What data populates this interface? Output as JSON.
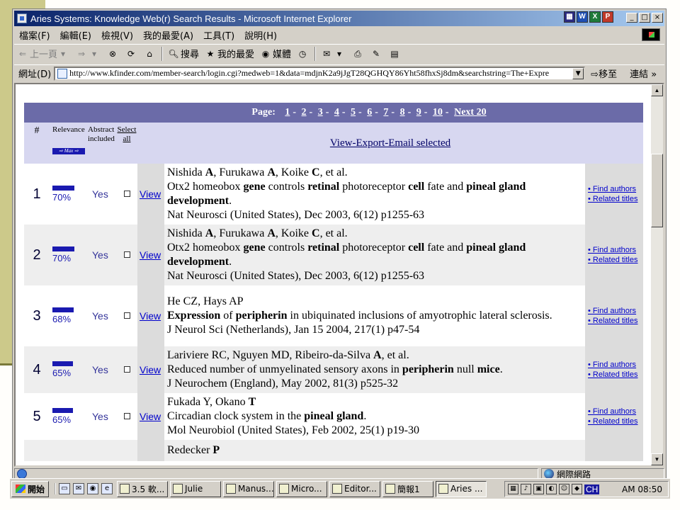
{
  "window": {
    "title": "Aries Systems: Knowledge Web(r) Search Results - Microsoft Internet Explorer",
    "buttons": [
      "_",
      "□",
      "×"
    ]
  },
  "menu": [
    "檔案(F)",
    "編輯(E)",
    "檢視(V)",
    "我的最愛(A)",
    "工具(T)",
    "說明(H)"
  ],
  "toolbar": {
    "back": "上一頁",
    "search": "搜尋",
    "favorites": "我的最愛",
    "media": "媒體"
  },
  "address": {
    "label": "網址(D)",
    "url": "http://www.kfinder.com/member-search/login.cgi?medweb=1&data=mdjnK2a9jJgT28QGHQY86Yht58fhxSj8dm&searchstring=The+Expre",
    "go": "移至",
    "links": "連結 »"
  },
  "pager": {
    "label": "Page:",
    "pages": [
      "1",
      "2",
      "3",
      "4",
      "5",
      "6",
      "7",
      "8",
      "9",
      "10"
    ],
    "next": "Next 20"
  },
  "table_header": {
    "num": "#",
    "relevance": "Relevance",
    "max": "⇨ Max ⇨",
    "abstract_1": "Abstract",
    "abstract_2": "included",
    "select_1": "Select",
    "select_2": "all",
    "export": "View-Export-Email selected"
  },
  "results": [
    {
      "num": "1",
      "relevance": "70%",
      "relevance_value": 70,
      "abstract": "Yes",
      "view": "View",
      "authors": [
        "Nishida ",
        "A",
        ", Furukawa ",
        "A",
        ", Koike ",
        "C",
        ", et al."
      ],
      "title_parts": [
        "Otx2 homeobox ",
        "gene",
        " controls ",
        "retinal",
        " photoreceptor ",
        "cell",
        " fate and ",
        "pineal gland development",
        "."
      ],
      "source": "Nat Neurosci (United States), Dec 2003, 6(12) p1255-63",
      "link1": "• Find authors",
      "link2": "• Related titles"
    },
    {
      "num": "2",
      "relevance": "70%",
      "relevance_value": 70,
      "abstract": "Yes",
      "view": "View",
      "authors": [
        "Nishida ",
        "A",
        ", Furukawa ",
        "A",
        ", Koike ",
        "C",
        ", et al."
      ],
      "title_parts": [
        "Otx2 homeobox ",
        "gene",
        " controls ",
        "retinal",
        " photoreceptor ",
        "cell",
        " fate and ",
        "pineal gland development",
        "."
      ],
      "source": "Nat Neurosci (United States), Dec 2003, 6(12) p1255-63",
      "link1": "• Find authors",
      "link2": "• Related titles"
    },
    {
      "num": "3",
      "relevance": "68%",
      "relevance_value": 68,
      "abstract": "Yes",
      "view": "View",
      "authors": [
        "He CZ, Hays AP",
        "",
        "",
        "",
        "",
        "",
        ""
      ],
      "title_parts": [
        "",
        "Expression",
        " of ",
        "peripherin",
        " in ubiquinated inclusions of amyotrophic lateral sclerosis.",
        "",
        "",
        "",
        ""
      ],
      "source": "J Neurol Sci (Netherlands), Jan 15 2004, 217(1) p47-54",
      "link1": "• Find authors",
      "link2": "• Related titles"
    },
    {
      "num": "4",
      "relevance": "65%",
      "relevance_value": 65,
      "abstract": "Yes",
      "view": "View",
      "authors": [
        "Lariviere RC, Nguyen MD, Ribeiro-da-Silva ",
        "A",
        ", et al.",
        "",
        "",
        "",
        ""
      ],
      "title_parts": [
        "Reduced number of unmyelinated sensory axons in ",
        "peripherin",
        " null ",
        "mice",
        ".",
        "",
        "",
        "",
        ""
      ],
      "source": "J Neurochem (England), May 2002, 81(3) p525-32",
      "link1": "• Find authors",
      "link2": "• Related titles"
    },
    {
      "num": "5",
      "relevance": "65%",
      "relevance_value": 65,
      "abstract": "Yes",
      "view": "View",
      "authors": [
        "Fukada Y, Okano ",
        "T",
        "",
        "",
        "",
        "",
        ""
      ],
      "title_parts": [
        "Circadian clock system in the ",
        "pineal gland",
        ".",
        "",
        "",
        "",
        "",
        "",
        ""
      ],
      "source": "Mol Neurobiol (United States), Feb 2002, 25(1) p19-30",
      "link1": "• Find authors",
      "link2": "• Related titles"
    },
    {
      "num": "",
      "relevance": "",
      "relevance_value": 0,
      "abstract": "",
      "view": "",
      "authors": [
        "Redecker ",
        "P",
        "",
        "",
        "",
        "",
        ""
      ],
      "title_parts": [
        "",
        "",
        "",
        "",
        "",
        "",
        "",
        "",
        ""
      ],
      "source": "",
      "link1": "",
      "link2": ""
    }
  ],
  "status": {
    "zone": "網際網路"
  },
  "taskbar": {
    "start": "開始",
    "tasks": [
      "3.5 軟...",
      "Julie",
      "Manus...",
      "Micro...",
      "Editor...",
      "簡報1",
      "Aries ..."
    ],
    "ime": "CH",
    "clock": "AM 08:50"
  }
}
